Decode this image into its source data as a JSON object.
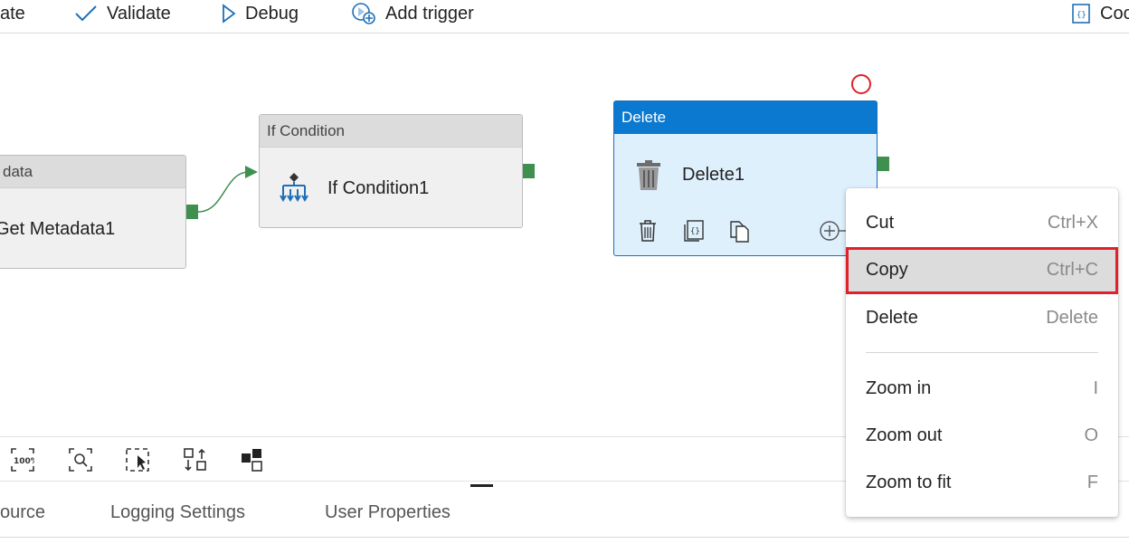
{
  "toolbar": {
    "publish_partial": "ate",
    "validate": "Validate",
    "debug": "Debug",
    "add_trigger": "Add trigger",
    "code_partial": "Coc"
  },
  "nodes": {
    "get_metadata": {
      "header": "data",
      "name": "Get Metadata1"
    },
    "if_condition": {
      "header": "If Condition",
      "name": "If Condition1"
    },
    "delete": {
      "header": "Delete",
      "name": "Delete1"
    }
  },
  "canvas_tools": [
    "zoom-100-icon",
    "zoom-search-icon",
    "select-icon",
    "auto-align-icon",
    "layout-icon"
  ],
  "tabs": {
    "source_partial": "ource",
    "logging": "Logging Settings",
    "user_props": "User Properties"
  },
  "context_menu": {
    "cut": {
      "label": "Cut",
      "shortcut": "Ctrl+X"
    },
    "copy": {
      "label": "Copy",
      "shortcut": "Ctrl+C"
    },
    "delete": {
      "label": "Delete",
      "shortcut": "Delete"
    },
    "zoom_in": {
      "label": "Zoom in",
      "shortcut": "I"
    },
    "zoom_out": {
      "label": "Zoom out",
      "shortcut": "O"
    },
    "zoom_fit": {
      "label": "Zoom to fit",
      "shortcut": "F"
    }
  },
  "colors": {
    "accent": "#0b79d0",
    "port_green": "#3f8f4f",
    "highlight_red": "#e0202a",
    "selected_bg": "#dff0fd"
  }
}
